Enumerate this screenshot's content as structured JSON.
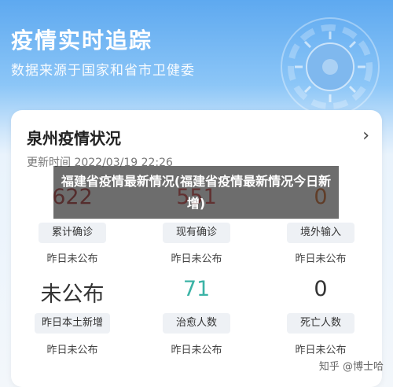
{
  "header": {
    "title": "疫情实时追踪",
    "subtitle": "数据来源于国家和省市卫健委"
  },
  "card": {
    "title": "泉州疫情状况",
    "chevron": "›",
    "update_time": "更新时间 2022/03/19 22:26",
    "row1": [
      {
        "value": "622",
        "label": "累计确诊",
        "delta": "昨日未公布",
        "color": "#b33a3a"
      },
      {
        "value": "551",
        "label": "现有确诊",
        "delta": "昨日未公布",
        "color": "#d84a4a"
      },
      {
        "value": "0",
        "label": "境外输入",
        "delta": "昨日未公布",
        "color": "#d76a2a"
      }
    ],
    "row2": [
      {
        "value": "未公布",
        "label": "昨日本土新增",
        "delta": "昨日未公布",
        "color": "#333333"
      },
      {
        "value": "71",
        "label": "治愈人数",
        "delta": "昨日未公布",
        "color": "#3bb3a6"
      },
      {
        "value": "0",
        "label": "死亡人数",
        "delta": "昨日未公布",
        "color": "#333333"
      }
    ]
  },
  "overlay": {
    "text": "福建省疫情最新情况(福建省疫情最新情况今日新增)"
  },
  "watermark": "知乎 @博士哈"
}
